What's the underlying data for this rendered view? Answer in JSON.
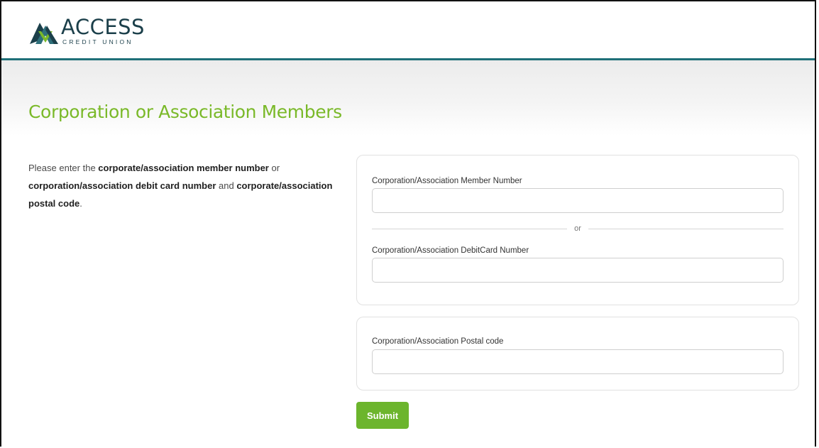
{
  "brand": {
    "name": "ACCESS",
    "tagline": "CREDIT UNION"
  },
  "page": {
    "title": "Corporation or Association Members"
  },
  "instructions": {
    "t1": "Please enter the ",
    "b1": "corporate/association member number",
    "t2": " or ",
    "b2": "corporation/association debit card number",
    "t3": " and ",
    "b3": "corporate/association postal code",
    "t4": "."
  },
  "form": {
    "member_number": {
      "label": "Corporation/Association Member Number",
      "value": "",
      "placeholder": ""
    },
    "divider_text": "or",
    "debit_card": {
      "label": "Corporation/Association DebitCard Number",
      "value": "",
      "placeholder": ""
    },
    "postal_code": {
      "label": "Corporation/Association Postal code",
      "value": "",
      "placeholder": ""
    },
    "submit_label": "Submit"
  },
  "colors": {
    "accent_green": "#7ab929",
    "button_green": "#6cb52d",
    "header_rule": "#1f6f78",
    "brand_dark": "#1b3f4a"
  }
}
